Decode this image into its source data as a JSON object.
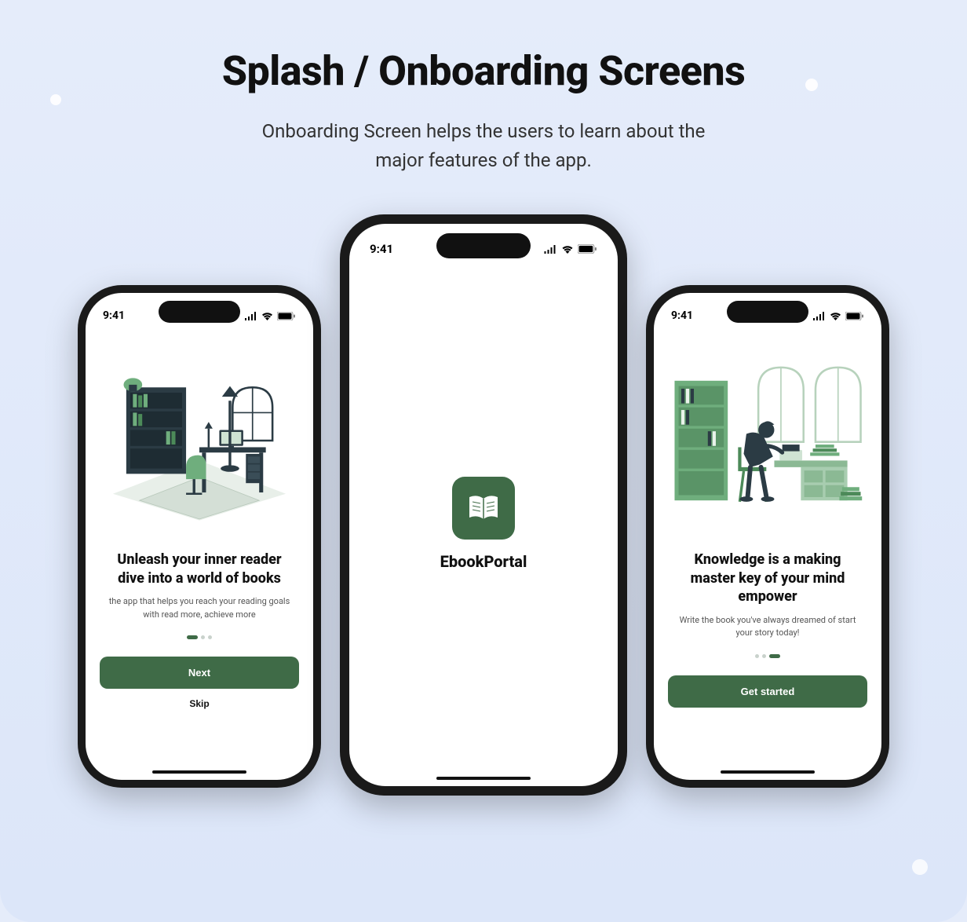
{
  "page": {
    "title": "Splash / Onboarding Screens",
    "subtitle_line1": "Onboarding Screen helps the users to learn about the",
    "subtitle_line2": "major features of the app."
  },
  "status": {
    "time": "9:41"
  },
  "colors": {
    "accent": "#3f6b47",
    "bg": "#e5ecfa",
    "text": "#111111"
  },
  "splash": {
    "app_name": "EbookPortal"
  },
  "screens": {
    "left": {
      "title": "Unleash your inner reader dive into a world of books",
      "subtitle": "the app that helps you reach your reading goals with read more, achieve more",
      "primary_button": "Next",
      "skip_button": "Skip",
      "pager_active_index": 0,
      "pager_count": 3
    },
    "right": {
      "title": "Knowledge is a making master key of your mind empower",
      "subtitle": "Write the book you've always dreamed of start your story today!",
      "primary_button": "Get started",
      "pager_active_index": 2,
      "pager_count": 3
    }
  }
}
